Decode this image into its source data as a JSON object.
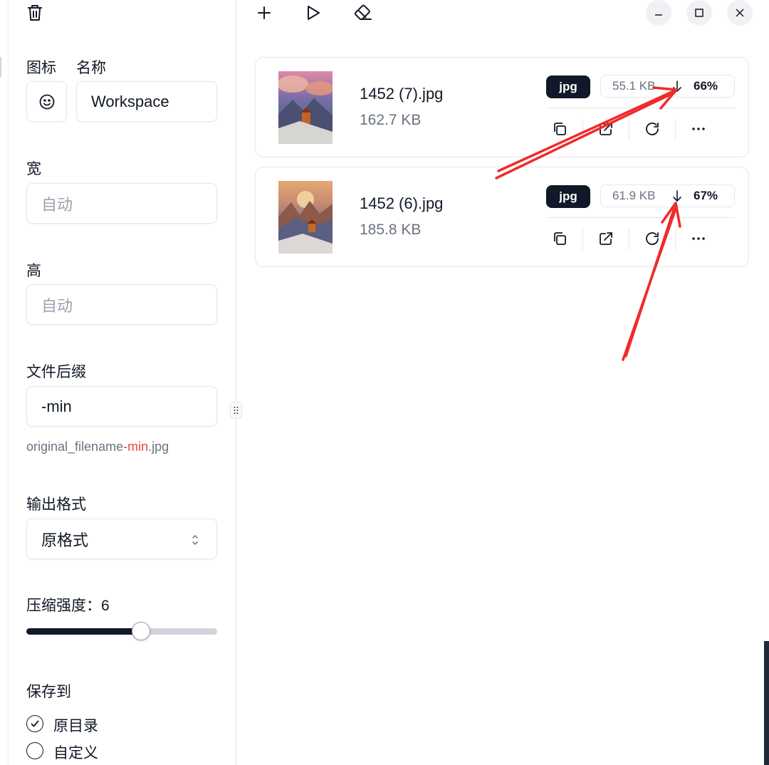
{
  "sidebar": {
    "trash_icon": "trash-icon",
    "icon_label": "图标",
    "name_label": "名称",
    "name_value": "Workspace",
    "width_label": "宽",
    "width_placeholder": "自动",
    "height_label": "高",
    "height_placeholder": "自动",
    "suffix_label": "文件后缀",
    "suffix_value": "-min",
    "suffix_hint_prefix": "original_filename",
    "suffix_hint_suffix": "min",
    "suffix_hint_ext": ".jpg",
    "suffix_hint_dash": "-",
    "format_label": "输出格式",
    "format_value": "原格式",
    "compression_label": "压缩强度：",
    "compression_value": "6",
    "compression_level": 6,
    "compression_max": 10,
    "save_label": "保存到",
    "save_options": [
      {
        "label": "原目录",
        "checked": true
      },
      {
        "label": "自定义",
        "checked": false
      }
    ]
  },
  "toolbar": {
    "add_icon": "plus-icon",
    "play_icon": "play-icon",
    "eraser_icon": "eraser-icon",
    "window": [
      "minimize-icon",
      "maximize-icon",
      "close-icon"
    ]
  },
  "files": [
    {
      "name": "1452 (7).jpg",
      "size": "162.7 KB",
      "format": "jpg",
      "compressed": "55.1 KB",
      "percent": "66%"
    },
    {
      "name": "1452 (6).jpg",
      "size": "185.8 KB",
      "format": "jpg",
      "compressed": "61.9 KB",
      "percent": "67%"
    }
  ],
  "colors": {
    "accent": "#111827",
    "hint_highlight": "#ef4444",
    "annotation": "#ef2b2b"
  }
}
